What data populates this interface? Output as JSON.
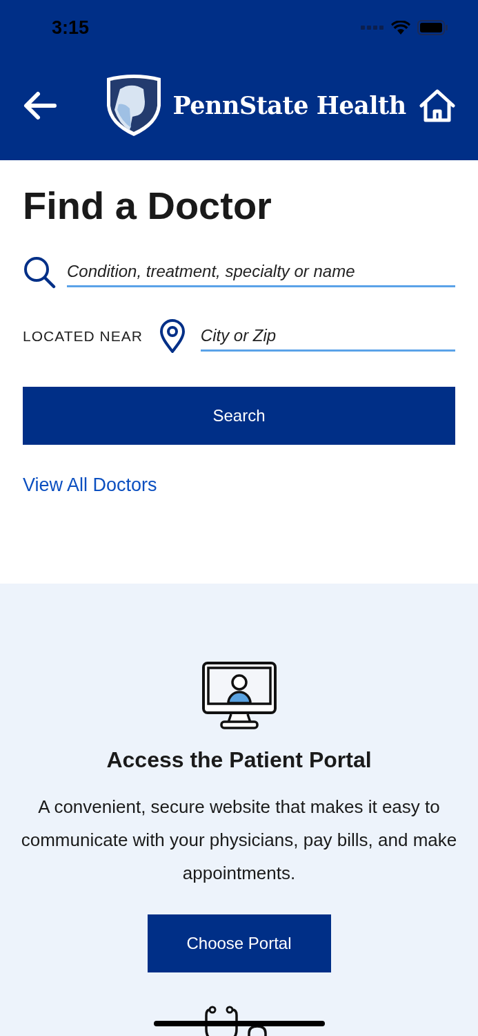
{
  "status_bar": {
    "time": "3:15"
  },
  "header": {
    "logo_text": "PennState Health"
  },
  "find_doctor": {
    "title": "Find a Doctor",
    "search": {
      "placeholder": "Condition, treatment, specialty or name"
    },
    "location_label": "LOCATED NEAR",
    "location": {
      "placeholder": "City or Zip"
    },
    "search_button": "Search",
    "view_all_link": "View All Doctors"
  },
  "portal": {
    "title": "Access the Patient Portal",
    "description": "A convenient, secure website that makes it easy to communicate with your physicians, pay bills, and make appointments.",
    "button": "Choose Portal"
  }
}
